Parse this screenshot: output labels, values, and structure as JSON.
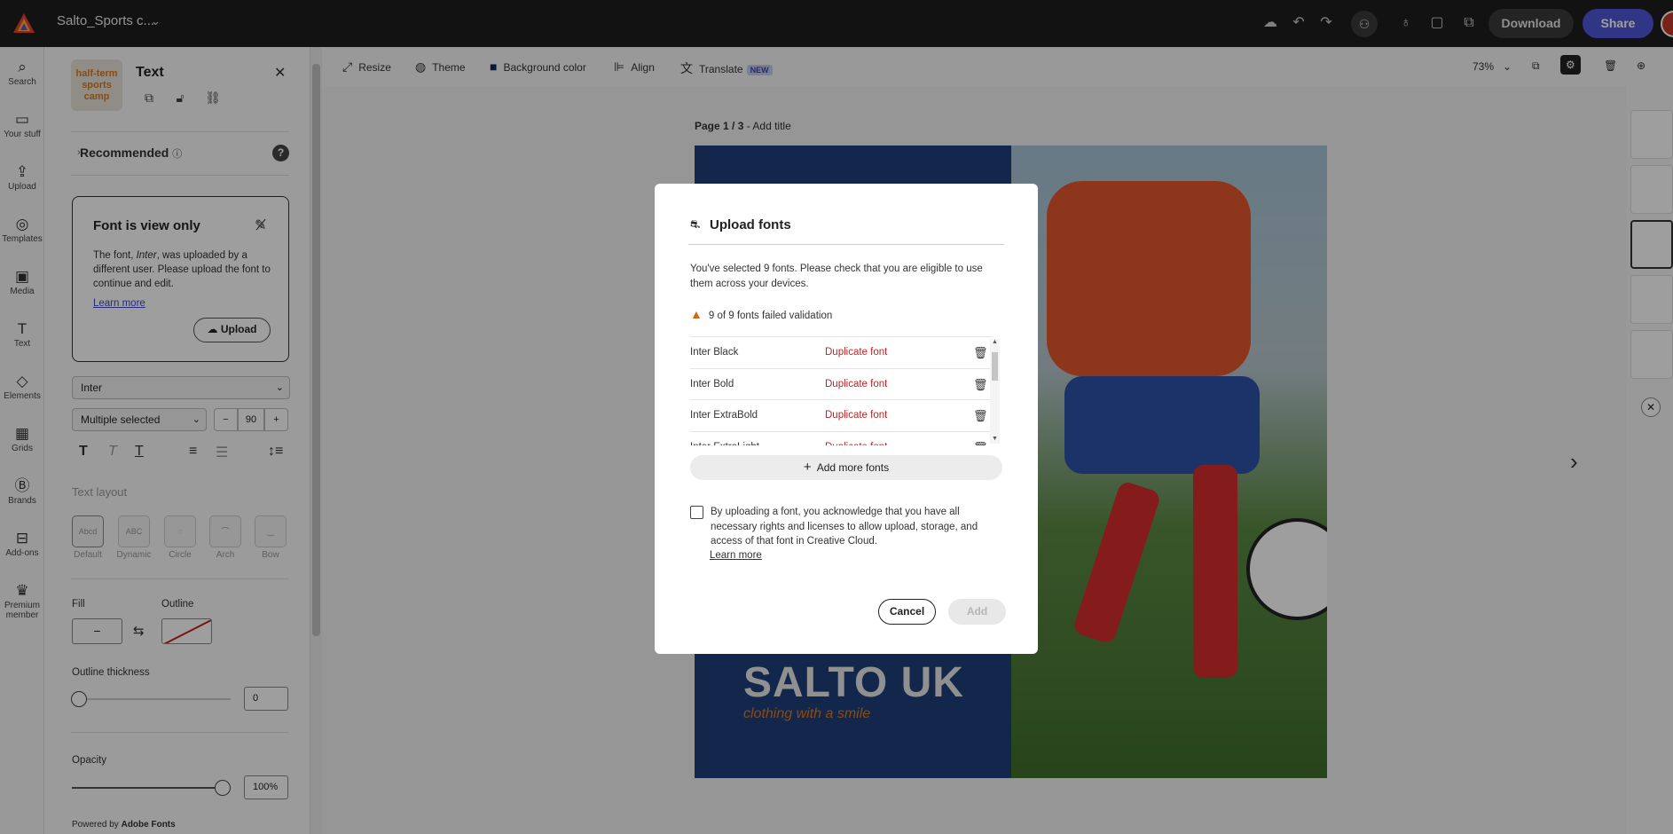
{
  "app": {
    "document_title": "Salto_Sports c..."
  },
  "topbar": {
    "download_label": "Download",
    "share_label": "Share"
  },
  "rail": {
    "items": [
      {
        "label": "Search",
        "icon": "search-icon",
        "glyph": "⌕"
      },
      {
        "label": "Your stuff",
        "icon": "folder-icon",
        "glyph": "▭"
      },
      {
        "label": "Upload",
        "icon": "upload-icon",
        "glyph": "⇪"
      },
      {
        "label": "Templates",
        "icon": "templates-icon",
        "glyph": "◎"
      },
      {
        "label": "Media",
        "icon": "media-icon",
        "glyph": "▣"
      },
      {
        "label": "Text",
        "icon": "text-icon",
        "glyph": "T"
      },
      {
        "label": "Elements",
        "icon": "elements-icon",
        "glyph": "◇"
      },
      {
        "label": "Grids",
        "icon": "grids-icon",
        "glyph": "▦"
      },
      {
        "label": "Brands",
        "icon": "brands-icon",
        "glyph": "Ⓑ"
      },
      {
        "label": "Add-ons",
        "icon": "addons-icon",
        "glyph": "⊟"
      },
      {
        "label": "Premium member",
        "icon": "premium-icon",
        "glyph": "♛"
      }
    ]
  },
  "panel": {
    "title": "Text",
    "thumb_text": "half-term sports camp",
    "recommended_label": "Recommended",
    "font_view_only": {
      "title": "Font is view only",
      "body_prefix": "The font, ",
      "font_name": "Inter",
      "body_suffix": ", was uploaded by a different user. Please upload the font to continue and edit.",
      "learn_more": "Learn more",
      "upload_label": "Upload"
    },
    "font_family": "Inter",
    "font_weight": "Multiple selected",
    "font_size": "90",
    "text_layout_label": "Text layout",
    "layouts": [
      {
        "label": "Default",
        "preview": "Abcd"
      },
      {
        "label": "Dynamic",
        "preview": "ABC"
      },
      {
        "label": "Circle",
        "preview": "◌"
      },
      {
        "label": "Arch",
        "preview": "⌒"
      },
      {
        "label": "Bow",
        "preview": "‿"
      }
    ],
    "fill_label": "Fill",
    "fill_value": "−",
    "outline_label": "Outline",
    "outline_thickness_label": "Outline thickness",
    "outline_thickness_value": "0",
    "opacity_label": "Opacity",
    "opacity_value": "100%",
    "powered_by_prefix": "Powered by",
    "powered_by_brand": "Adobe Fonts"
  },
  "toolbar": {
    "resize": "Resize",
    "theme": "Theme",
    "background_color": "Background color",
    "align": "Align",
    "translate": "Translate",
    "new_badge": "NEW",
    "zoom": "73%"
  },
  "canvas": {
    "page_label": "Page 1 / 3",
    "add_title": "Add title",
    "brand_text": "SALTO UK",
    "tagline_text": "clothing with a smile"
  },
  "modal": {
    "title": "Upload fonts",
    "description": "You've selected 9 fonts. Please check that you are eligible to use them across your devices.",
    "warning": "9 of 9 fonts failed validation",
    "fonts": [
      {
        "name": "Inter Black",
        "status": "Duplicate font"
      },
      {
        "name": "Inter Bold",
        "status": "Duplicate font"
      },
      {
        "name": "Inter ExtraBold",
        "status": "Duplicate font"
      },
      {
        "name": "Inter ExtraLight",
        "status": "Duplicate font"
      }
    ],
    "add_more_label": "Add more fonts",
    "legal_text": "By uploading a font, you acknowledge that you have all necessary rights and licenses to allow upload, storage, and access of that font in Creative Cloud.",
    "learn_more": "Learn more",
    "cancel_label": "Cancel",
    "add_label": "Add"
  },
  "colors": {
    "accent": "#4f56d8",
    "error": "#c42121",
    "warning": "#d06a10",
    "topbar": "#1d1d1d"
  }
}
